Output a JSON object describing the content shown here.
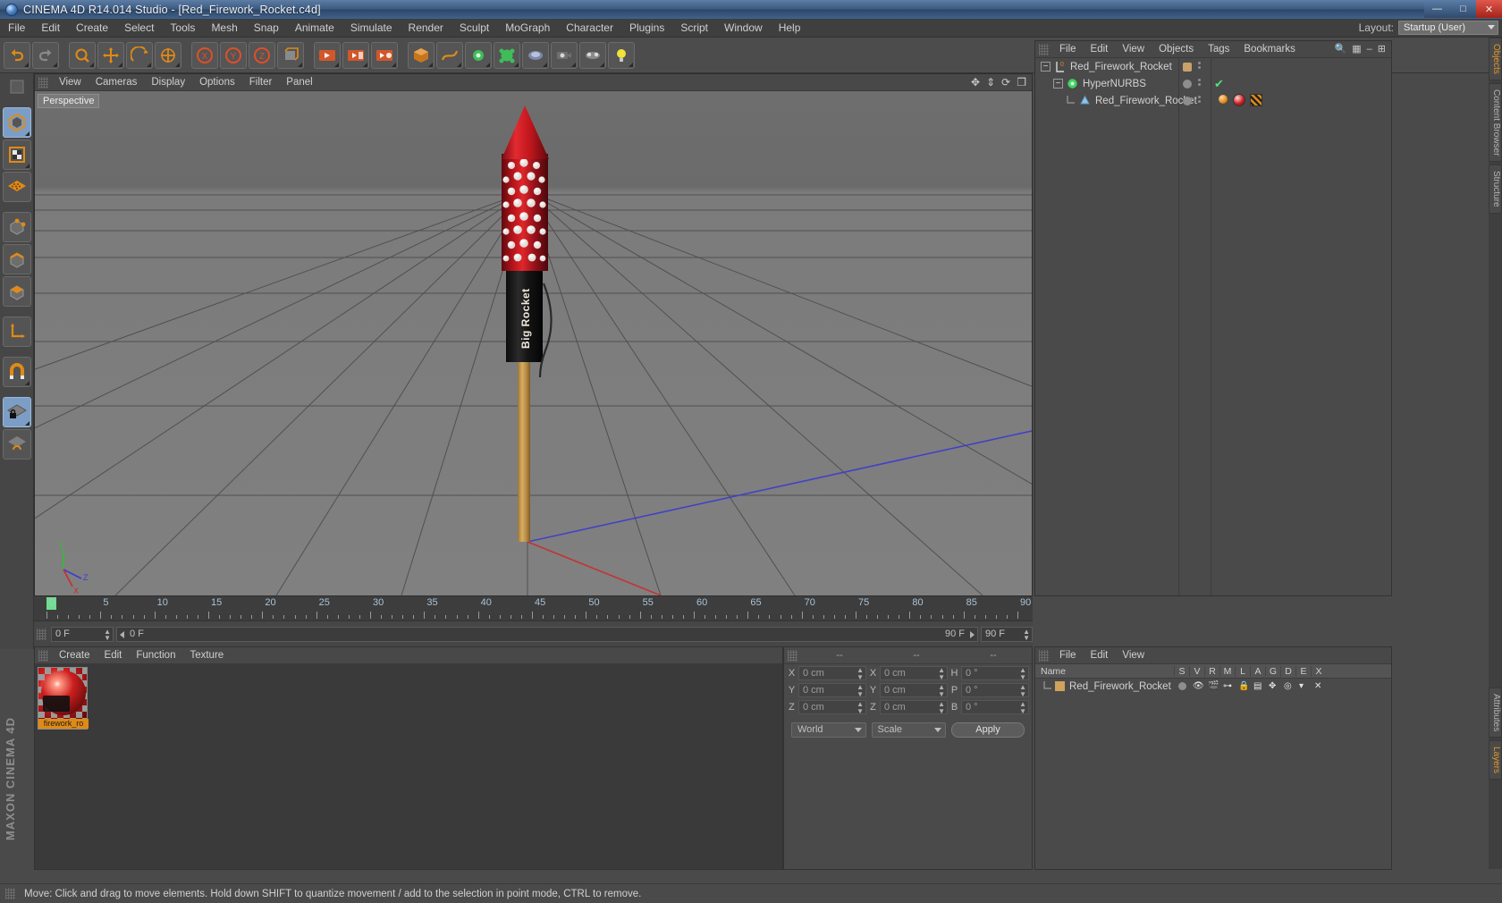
{
  "window": {
    "title": "CINEMA 4D R14.014 Studio - [Red_Firework_Rocket.c4d]",
    "app_icon": "cinema4d-logo-icon",
    "minimize": "—",
    "maximize": "□",
    "close": "✕"
  },
  "menubar": {
    "items": [
      "File",
      "Edit",
      "Create",
      "Select",
      "Tools",
      "Mesh",
      "Snap",
      "Animate",
      "Simulate",
      "Render",
      "Sculpt",
      "MoGraph",
      "Character",
      "Plugins",
      "Script",
      "Window",
      "Help"
    ],
    "layout_label": "Layout:",
    "layout_value": "Startup (User)"
  },
  "viewport": {
    "menu": [
      "View",
      "Cameras",
      "Display",
      "Options",
      "Filter",
      "Panel"
    ],
    "camera_tag": "Perspective",
    "icons": [
      "pan-icon",
      "zoom-icon",
      "rotate-icon",
      "maximize-view-icon"
    ]
  },
  "timeline": {
    "ticks": [
      0,
      5,
      10,
      15,
      20,
      25,
      30,
      35,
      40,
      45,
      50,
      55,
      60,
      65,
      70,
      75,
      80,
      85,
      90
    ],
    "current_frame": "0 F",
    "range_start": "0 F",
    "range_end": "90 F",
    "end_frame": "90 F",
    "preview_end": "90 F"
  },
  "transport": {
    "buttons": [
      "go-to-start",
      "frame-back",
      "play-back",
      "play",
      "frame-forward",
      "loop",
      "go-to-end",
      "record-keyframe",
      "autokey",
      "keyframe-selection-help"
    ],
    "mode_buttons": [
      "move-tool",
      "scale-tool",
      "rotate-tool",
      "position-tool",
      "point-mode",
      "film-mode"
    ]
  },
  "material_manager": {
    "menu": [
      "Create",
      "Edit",
      "Function",
      "Texture"
    ],
    "materials": [
      {
        "name": "firework_ro",
        "preview": "red-dotted-sphere"
      }
    ]
  },
  "coordinate_manager": {
    "headers": [
      "--",
      "--",
      "--"
    ],
    "rows": [
      {
        "pos_label": "X",
        "pos_value": "0 cm",
        "size_label": "X",
        "size_value": "0 cm",
        "rot_label": "H",
        "rot_value": "0 °"
      },
      {
        "pos_label": "Y",
        "pos_value": "0 cm",
        "size_label": "Y",
        "size_value": "0 cm",
        "rot_label": "P",
        "rot_value": "0 °"
      },
      {
        "pos_label": "Z",
        "pos_value": "0 cm",
        "size_label": "Z",
        "size_value": "0 cm",
        "rot_label": "B",
        "rot_value": "0 °"
      }
    ],
    "coord_system": "World",
    "transform_mode": "Scale",
    "apply_label": "Apply"
  },
  "object_manager": {
    "menu": [
      "File",
      "Edit",
      "View",
      "Objects",
      "Tags",
      "Bookmarks"
    ],
    "search_icons": [
      "search-icon",
      "filter-icon",
      "minus-icon",
      "add-icon"
    ],
    "objects": [
      {
        "name": "Red_Firework_Rocket",
        "indent": 0,
        "icon": "null-object-icon",
        "icon_color": "#cfa35c",
        "expander": "minus",
        "visible_dot_color": "#c9a26a",
        "check": false
      },
      {
        "name": "HyperNURBS",
        "indent": 1,
        "icon": "hypernurbs-icon",
        "icon_color": "#4fd16a",
        "expander": "minus",
        "visible_dot_color": "#8e8e8e",
        "check": true
      },
      {
        "name": "Red_Firework_Rocket",
        "indent": 2,
        "icon": "polygon-object-icon",
        "icon_color": "#7fb8e0",
        "expander": "none",
        "visible_dot_color": "#8e8e8e",
        "check": false,
        "tags": [
          "material-tag",
          "texture-tag",
          "uv-tag"
        ]
      }
    ]
  },
  "layer_manager": {
    "menu": [
      "File",
      "Edit",
      "View"
    ],
    "columns": [
      "Name",
      "S",
      "V",
      "R",
      "M",
      "L",
      "A",
      "G",
      "D",
      "E",
      "X"
    ],
    "rows": [
      {
        "name": "Red_Firework_Rocket",
        "color": "#cfa35c"
      }
    ]
  },
  "right_tabs": [
    {
      "label": "Objects",
      "selected": true
    },
    {
      "label": "Content Browser",
      "selected": false
    },
    {
      "label": "Structure",
      "selected": false
    },
    {
      "label": "Attributes",
      "selected": false
    },
    {
      "label": "Layers",
      "selected": false
    }
  ],
  "left_tools": [
    {
      "name": "model-mode-icon",
      "active": true
    },
    {
      "name": "texture-mode-icon",
      "active": false
    },
    {
      "name": "polygon-grid-icon",
      "active": false
    },
    {
      "name": "points-mode-icon",
      "active": false
    },
    {
      "name": "edges-mode-icon",
      "active": false
    },
    {
      "name": "polygons-mode-icon",
      "active": false
    },
    {
      "name": "axis-mode-icon",
      "active": false
    },
    {
      "name": "magnet-icon",
      "active": false
    },
    {
      "name": "lock-grid-icon",
      "active": true
    },
    {
      "name": "workplane-icon",
      "active": false
    }
  ],
  "toolbar": {
    "buttons": [
      "undo-icon",
      "redo-icon",
      "select-live-icon",
      "move-icon",
      "scale-icon",
      "rotate-icon",
      "world-axis-icon",
      "lock-x-icon",
      "lock-y-icon",
      "lock-z-icon",
      "render-view-icon",
      "render-region-icon",
      "render-settings-icon",
      "render-picture-icon",
      "primitive-cube-icon",
      "spline-icon",
      "generator-icon",
      "mograph-icon",
      "deformer-icon",
      "camera-icon",
      "floor-icon",
      "light-icon"
    ]
  },
  "branding": {
    "text": "MAXON CINEMA 4D"
  },
  "status": {
    "text": "Move: Click and drag to move elements. Hold down SHIFT to quantize movement / add to the selection in point mode, CTRL to remove."
  }
}
